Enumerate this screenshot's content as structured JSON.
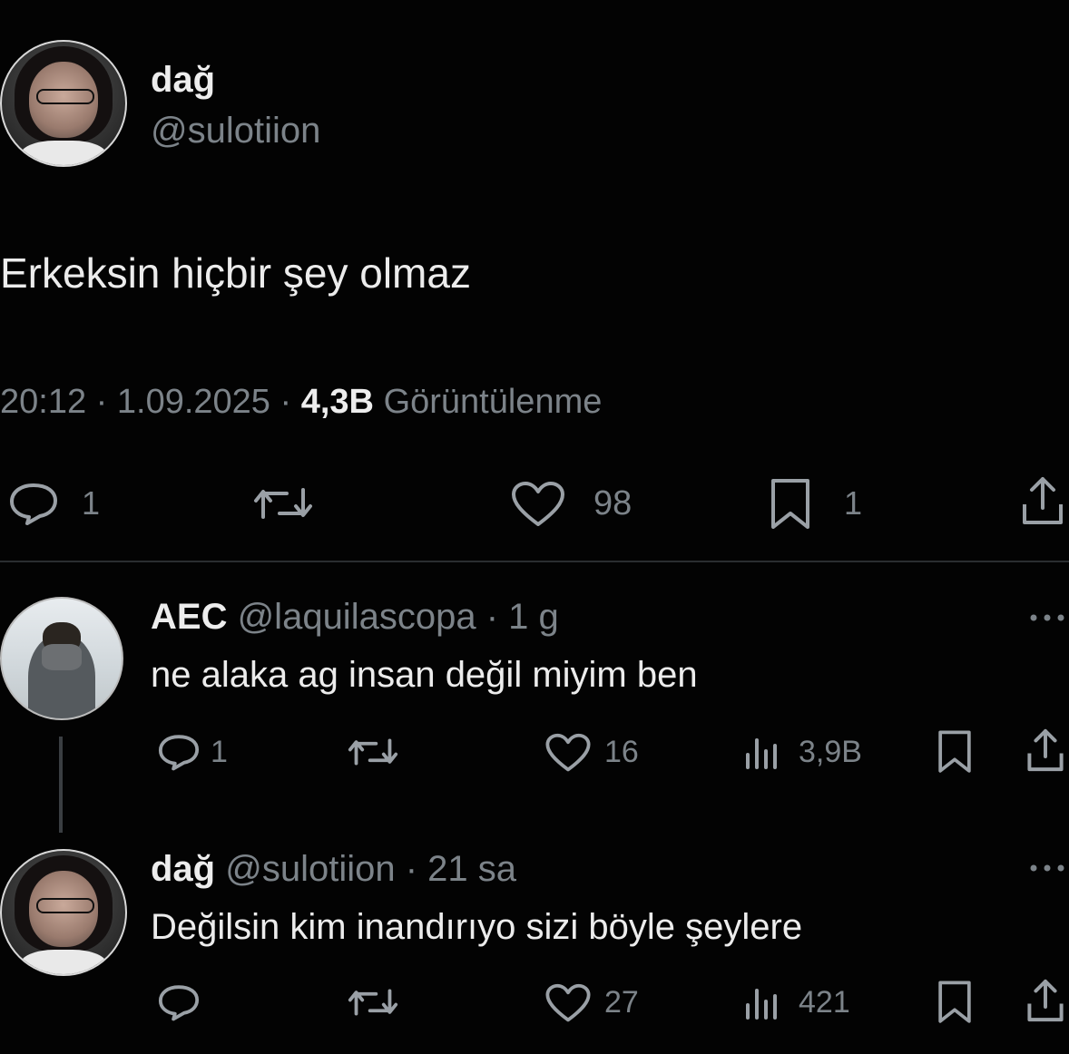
{
  "tweet": {
    "author_name": "dağ",
    "author_handle": "@sulotiion",
    "text": "Erkeksin hiçbir şey olmaz",
    "time": "20:12",
    "date": "1.09.2025",
    "views_count": "4,3B",
    "views_label": "Görüntülenme",
    "separator": "·",
    "stats": {
      "replies": "1",
      "likes": "98",
      "bookmarks": "1"
    }
  },
  "replies": [
    {
      "author_name": "AEC",
      "author_handle": "@laquilascopa",
      "age": "· 1 g",
      "text": "ne alaka ag insan değil miyim ben",
      "stats": {
        "replies": "1",
        "likes": "16",
        "views": "3,9B"
      }
    },
    {
      "author_name": "dağ",
      "author_handle": "@sulotiion",
      "age": "· 21 sa",
      "text": "Değilsin kim inandırıyo sizi böyle şeylere",
      "stats": {
        "replies": "",
        "likes": "27",
        "views": "421"
      }
    }
  ],
  "colors": {
    "background": "#030303",
    "primary_text": "#e8eaec",
    "secondary_text": "#7c8389",
    "divider": "#2a2d30"
  },
  "icons": [
    "reply-icon",
    "retweet-icon",
    "like-icon",
    "bookmark-icon",
    "share-icon",
    "views-icon",
    "more-icon"
  ]
}
